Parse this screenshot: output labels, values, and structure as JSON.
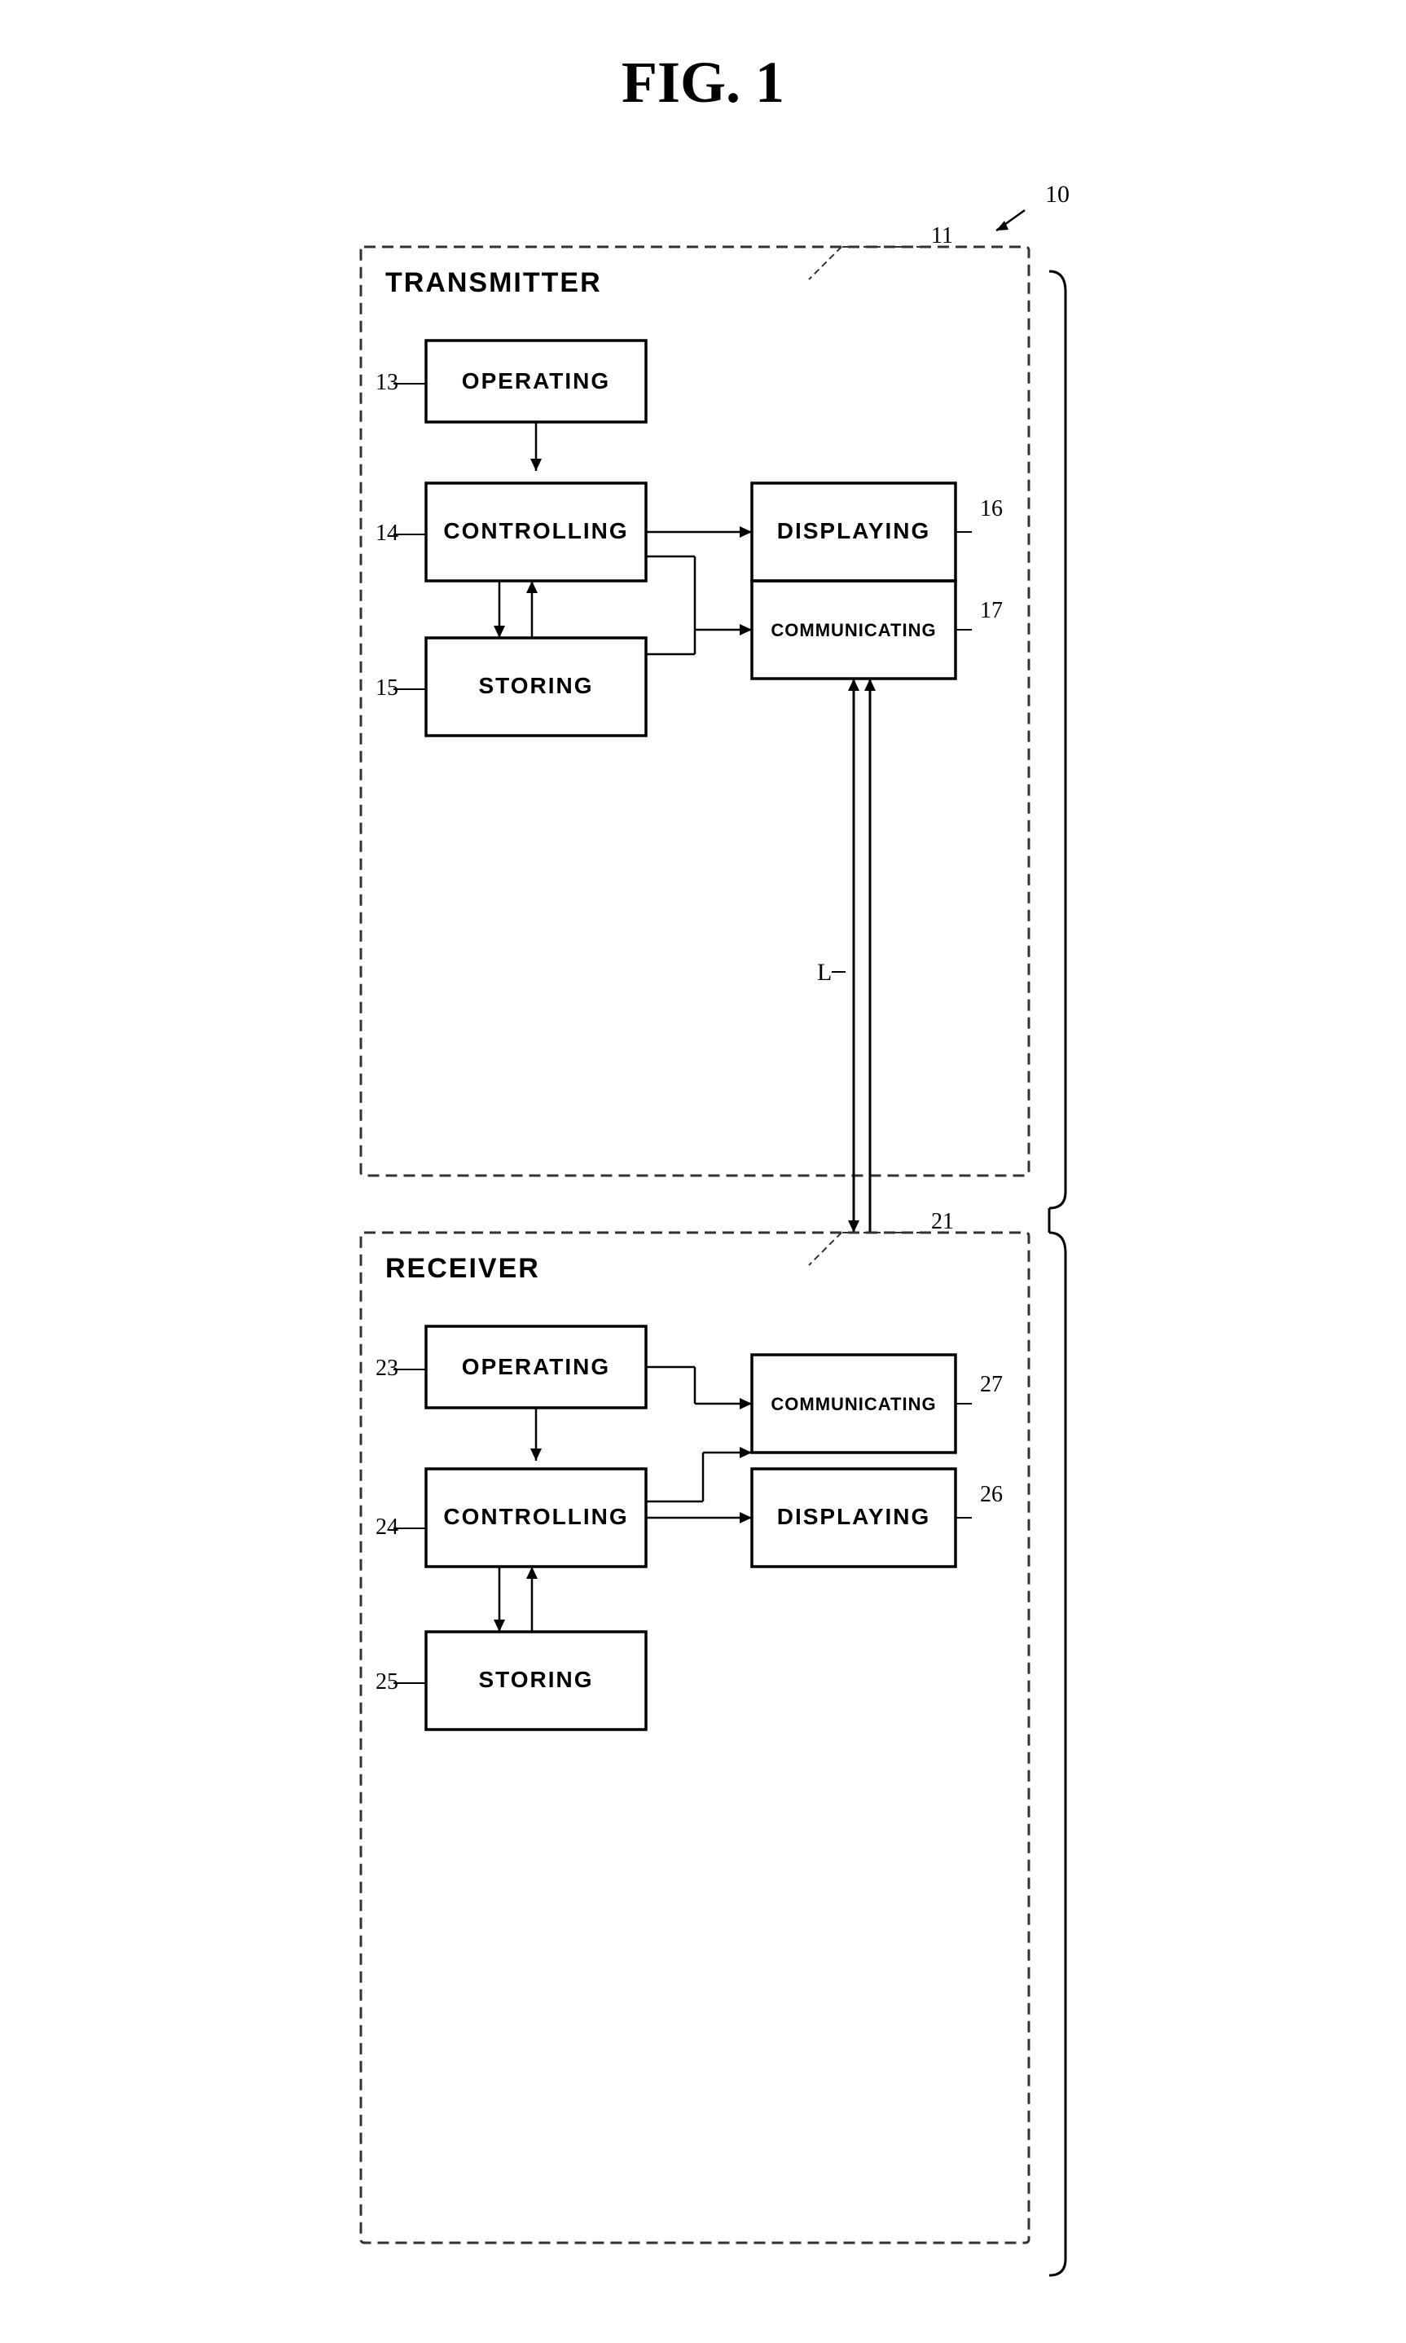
{
  "figure": {
    "title": "FIG. 1",
    "ref_10": "10",
    "ref_L": "L",
    "transmitter": {
      "label": "TRANSMITTER",
      "ref": "11",
      "blocks": {
        "operating": {
          "label": "OPERATING",
          "ref": "13"
        },
        "controlling": {
          "label": "CONTROLLING",
          "ref": "14"
        },
        "storing": {
          "label": "STORING",
          "ref": "15"
        },
        "displaying": {
          "label": "DISPLAYING",
          "ref": "16"
        },
        "communicating": {
          "label": "COMMUNICATING",
          "ref": "17"
        }
      }
    },
    "receiver": {
      "label": "RECEIVER",
      "ref": "21",
      "blocks": {
        "operating": {
          "label": "OPERATING",
          "ref": "23"
        },
        "controlling": {
          "label": "CONTROLLING",
          "ref": "24"
        },
        "storing": {
          "label": "STORING",
          "ref": "25"
        },
        "displaying": {
          "label": "DISPLAYING",
          "ref": "26"
        },
        "communicating": {
          "label": "COMMUNICATING",
          "ref": "27"
        }
      }
    }
  }
}
